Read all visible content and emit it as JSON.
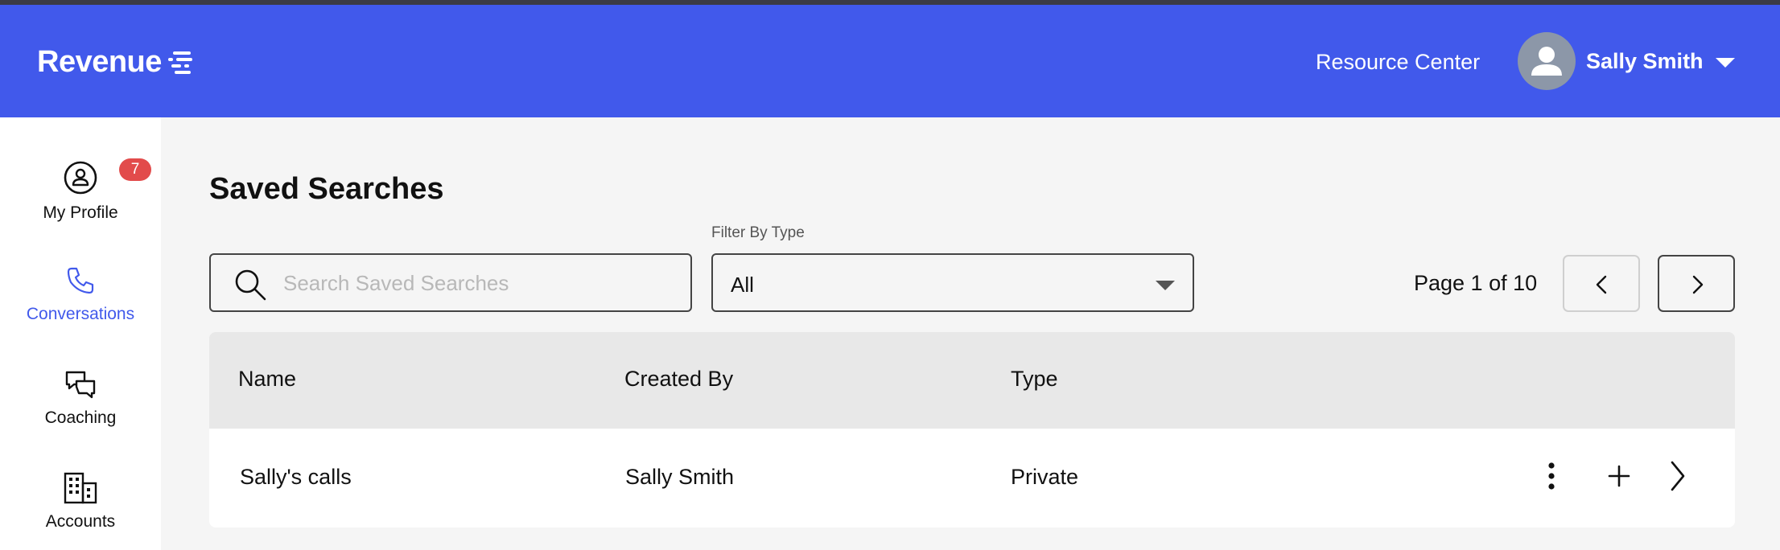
{
  "header": {
    "logo_text": "Revenue",
    "resource_center": "Resource Center",
    "user_name": "Sally Smith"
  },
  "sidebar": {
    "items": [
      {
        "label": "My Profile",
        "icon": "user-circle-icon",
        "badge": "7",
        "active": false
      },
      {
        "label": "Conversations",
        "icon": "phone-icon",
        "active": true
      },
      {
        "label": "Coaching",
        "icon": "chat-bubbles-icon",
        "active": false
      },
      {
        "label": "Accounts",
        "icon": "building-icon",
        "active": false
      }
    ]
  },
  "main": {
    "title": "Saved Searches",
    "search": {
      "placeholder": "Search Saved Searches",
      "value": ""
    },
    "filter": {
      "label": "Filter By Type",
      "value": "All"
    },
    "pagination": {
      "text": "Page 1 of 10"
    },
    "table": {
      "columns": [
        "Name",
        "Created By",
        "Type"
      ],
      "rows": [
        {
          "name": "Sally's calls",
          "created_by": "Sally Smith",
          "type": "Private"
        }
      ]
    }
  },
  "colors": {
    "brand": "#4159eb",
    "badge": "#e24b4b",
    "page_background": "#f5f5f5",
    "table_header": "#e8e8e8"
  }
}
